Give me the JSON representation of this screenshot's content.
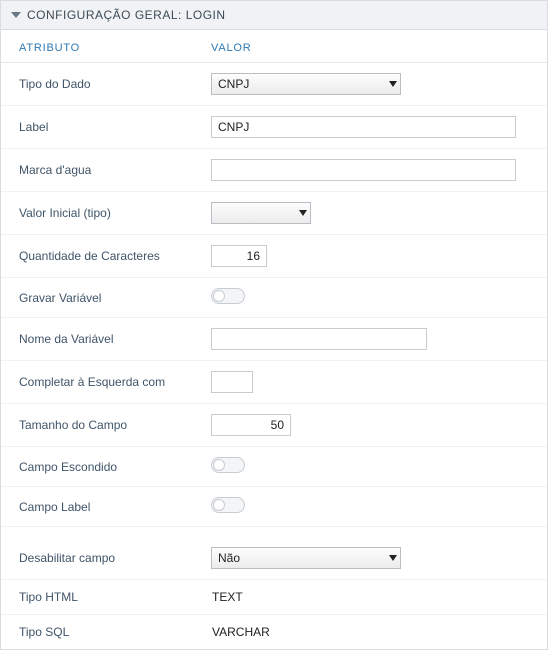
{
  "panel": {
    "title": "CONFIGURAÇÃO GERAL: LOGIN"
  },
  "columns": {
    "attr": "ATRIBUTO",
    "val": "VALOR"
  },
  "rows": {
    "tipo_dado": {
      "label": "Tipo do Dado",
      "value": "CNPJ"
    },
    "label": {
      "label": "Label",
      "value": "CNPJ"
    },
    "marca": {
      "label": "Marca d'agua",
      "value": ""
    },
    "valor_ini": {
      "label": "Valor Inicial (tipo)",
      "value": ""
    },
    "qtd_char": {
      "label": "Quantidade de Caracteres",
      "value": "16"
    },
    "gravar": {
      "label": "Gravar Variável"
    },
    "nome_var": {
      "label": "Nome da Variável",
      "value": ""
    },
    "comp_esq": {
      "label": "Completar à Esquerda com",
      "value": ""
    },
    "tam_campo": {
      "label": "Tamanho do Campo",
      "value": "50"
    },
    "escondido": {
      "label": "Campo Escondido"
    },
    "clabel": {
      "label": "Campo Label"
    },
    "desab": {
      "label": "Desabilitar campo",
      "value": "Não"
    },
    "tipo_html": {
      "label": "Tipo HTML",
      "value": "TEXT"
    },
    "tipo_sql": {
      "label": "Tipo SQL",
      "value": "VARCHAR"
    }
  }
}
